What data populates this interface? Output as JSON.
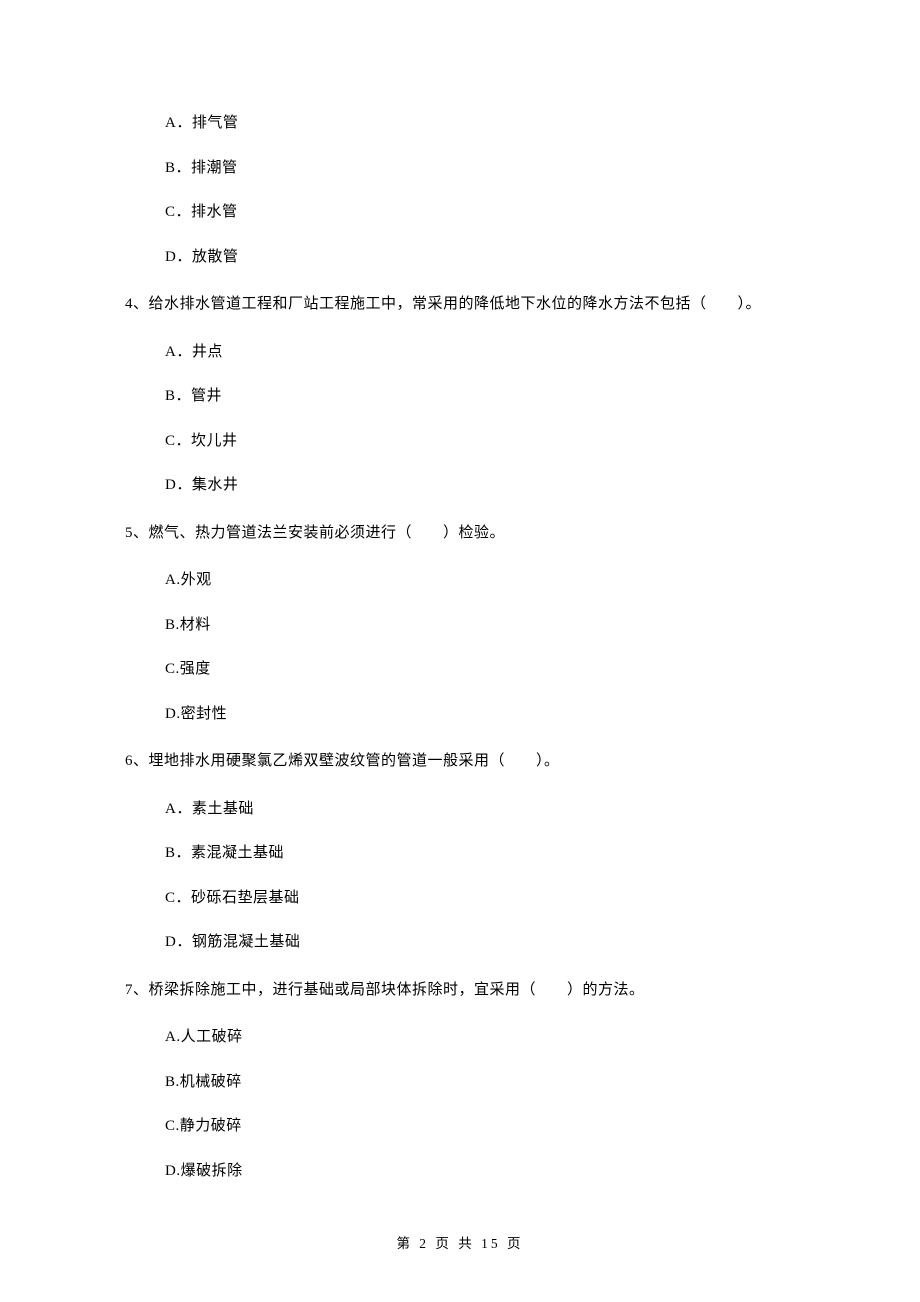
{
  "q3_options": {
    "a": "A．排气管",
    "b": "B．排潮管",
    "c": "C．排水管",
    "d": "D．放散管"
  },
  "questions": {
    "q4": {
      "text": "4、给水排水管道工程和厂站工程施工中，常采用的降低地下水位的降水方法不包括（　　）。",
      "options": {
        "a": "A．井点",
        "b": "B．管井",
        "c": "C．坎儿井",
        "d": "D．集水井"
      }
    },
    "q5": {
      "text": "5、燃气、热力管道法兰安装前必须进行（　　）检验。",
      "options": {
        "a": "A.外观",
        "b": "B.材料",
        "c": "C.强度",
        "d": "D.密封性"
      }
    },
    "q6": {
      "text": "6、埋地排水用硬聚氯乙烯双壁波纹管的管道一般采用（　　）。",
      "options": {
        "a": "A．素土基础",
        "b": "B．素混凝土基础",
        "c": "C．砂砾石垫层基础",
        "d": "D．钢筋混凝土基础"
      }
    },
    "q7": {
      "text": "7、桥梁拆除施工中，进行基础或局部块体拆除时，宜采用（　　）的方法。",
      "options": {
        "a": "A.人工破碎",
        "b": "B.机械破碎",
        "c": "C.静力破碎",
        "d": "D.爆破拆除"
      }
    }
  },
  "footer": "第 2 页 共 15 页"
}
